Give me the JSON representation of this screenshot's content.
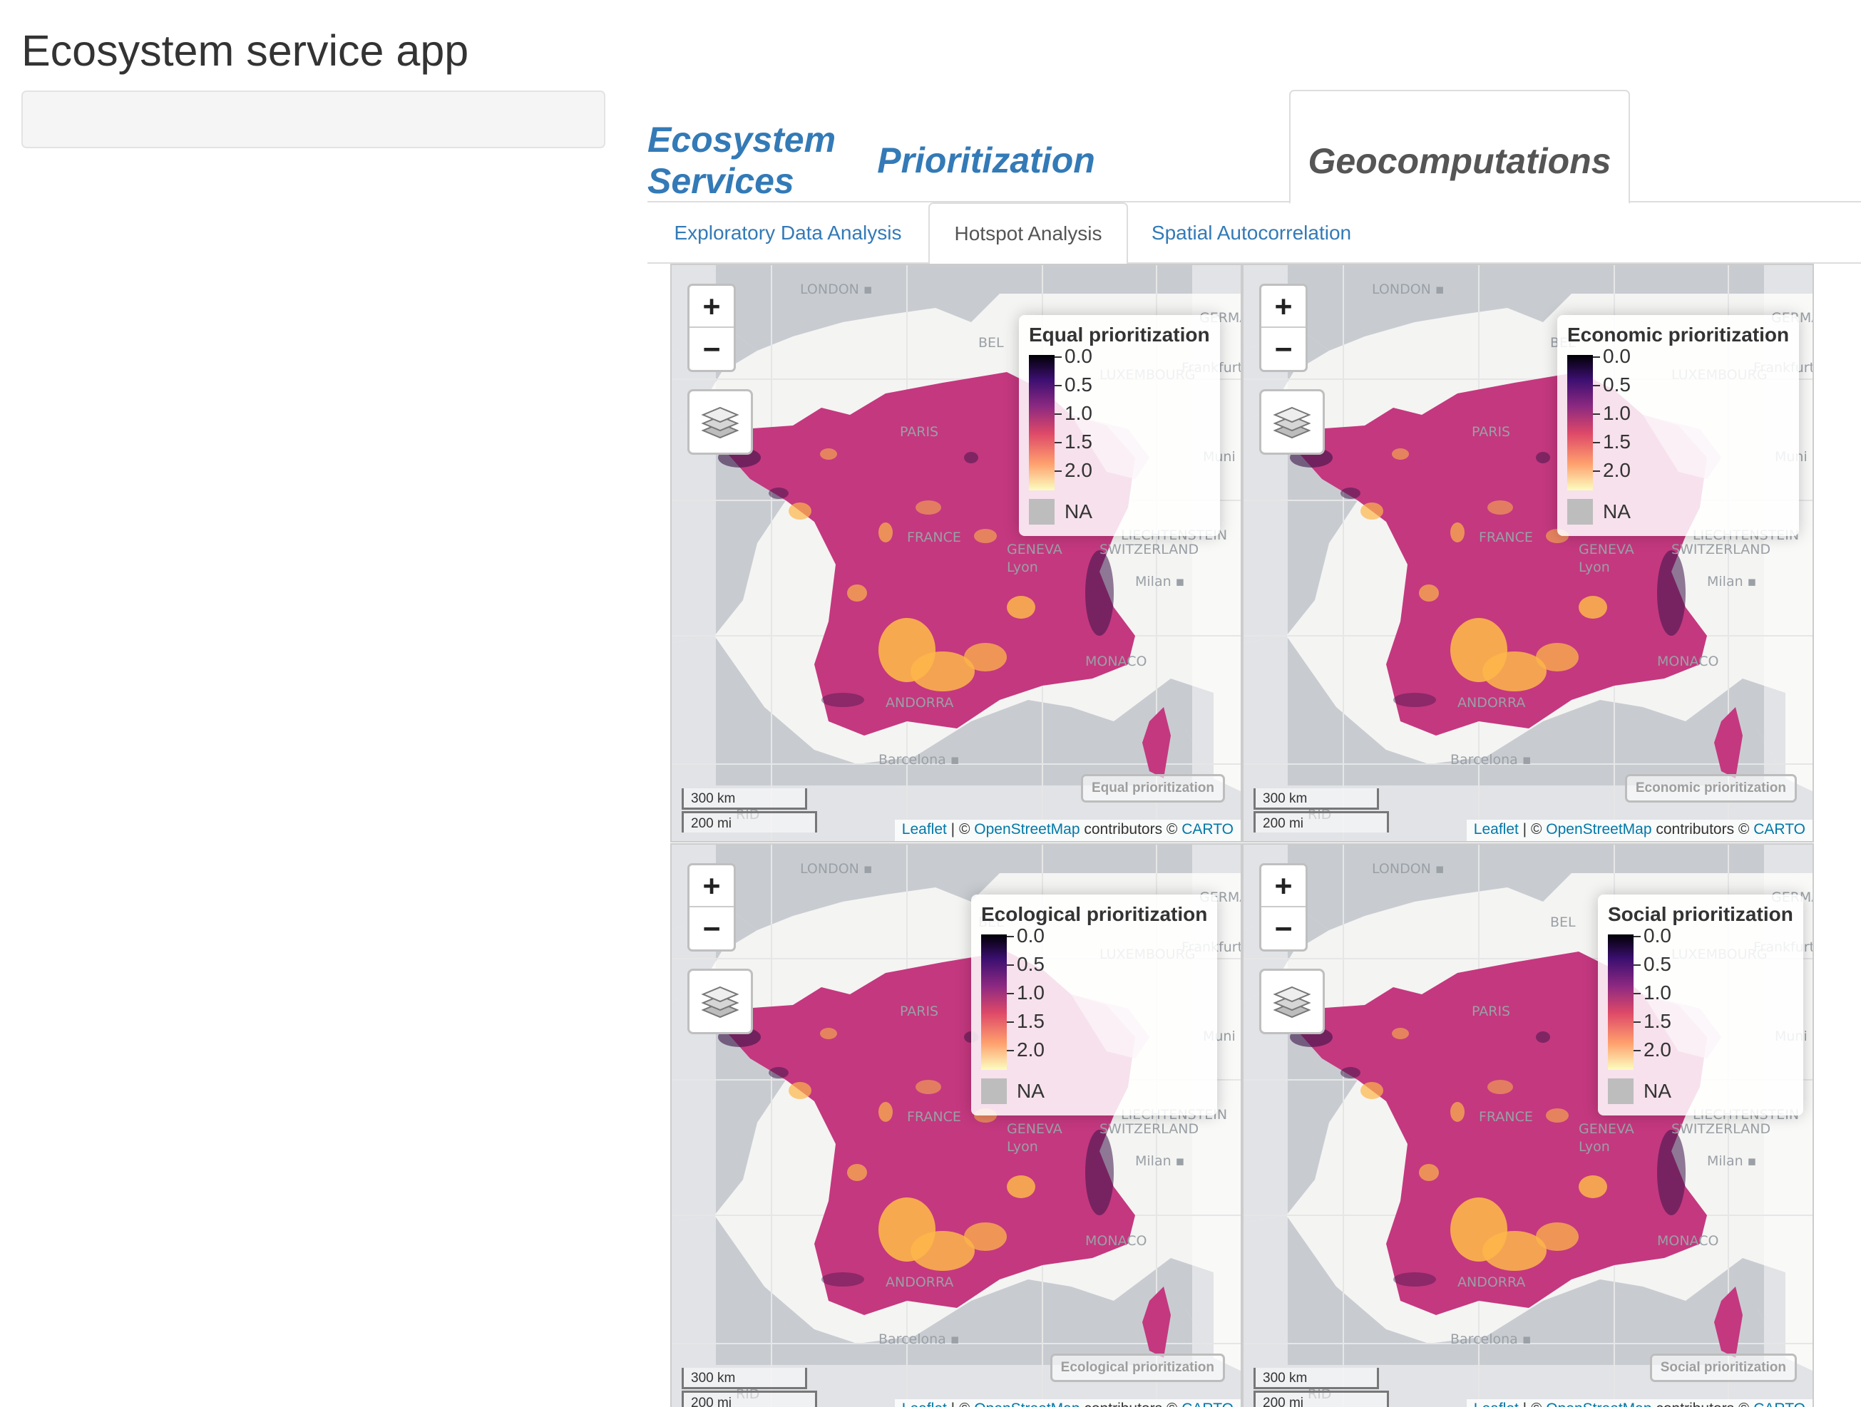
{
  "app": {
    "title": "Ecosystem service app"
  },
  "main_tabs": [
    {
      "label": "Ecosystem Services",
      "active": false
    },
    {
      "label": "Prioritization",
      "active": false
    },
    {
      "label": "Geocomputations",
      "active": true
    }
  ],
  "sub_tabs": [
    {
      "label": "Exploratory Data Analysis",
      "active": false
    },
    {
      "label": "Hotspot Analysis",
      "active": true
    },
    {
      "label": "Spatial Autocorrelation",
      "active": false
    }
  ],
  "map_common": {
    "zoom_in": "+",
    "zoom_out": "−",
    "scale_km": "300 km",
    "scale_mi": "200 mi",
    "attribution": {
      "leaflet": "Leaflet",
      "sep1": " | © ",
      "osm": "OpenStreetMap",
      "contrib": " contributors © ",
      "carto": "CARTO"
    },
    "legend_ticks": [
      "0.0",
      "0.5",
      "1.0",
      "1.5",
      "2.0"
    ],
    "legend_na": "NA",
    "colors": {
      "base": "#c4387f",
      "hot": "#fdb64a",
      "cold": "#3b1248",
      "sea": "#c8ccd1",
      "land": "#f4f4f2"
    },
    "basemap_labels": {
      "london": "LONDON",
      "paris": "PARIS",
      "france": "FRANCE",
      "geneva": "GENEVA",
      "lyon": "Lyon",
      "milan": "Milan",
      "monaco": "MONACO",
      "andorra": "ANDORRA",
      "barcelona": "Barcelona",
      "luxembourg": "LUXEMBOURG",
      "liechtenstein": "LIECHTENSTEIN",
      "switzerland": "SWITZERLAND",
      "frankfurt": "Frankfurt",
      "munich": "Muni",
      "germany": "GERMA",
      "belgium": "BEL",
      "madrid": "RID"
    }
  },
  "maps": [
    {
      "legend_title": "Equal prioritization",
      "layer_label": "Equal prioritization"
    },
    {
      "legend_title": "Economic prioritization",
      "layer_label": "Economic prioritization"
    },
    {
      "legend_title": "Ecological prioritization",
      "layer_label": "Ecological prioritization"
    },
    {
      "legend_title": "Social prioritization",
      "layer_label": "Social prioritization"
    }
  ]
}
